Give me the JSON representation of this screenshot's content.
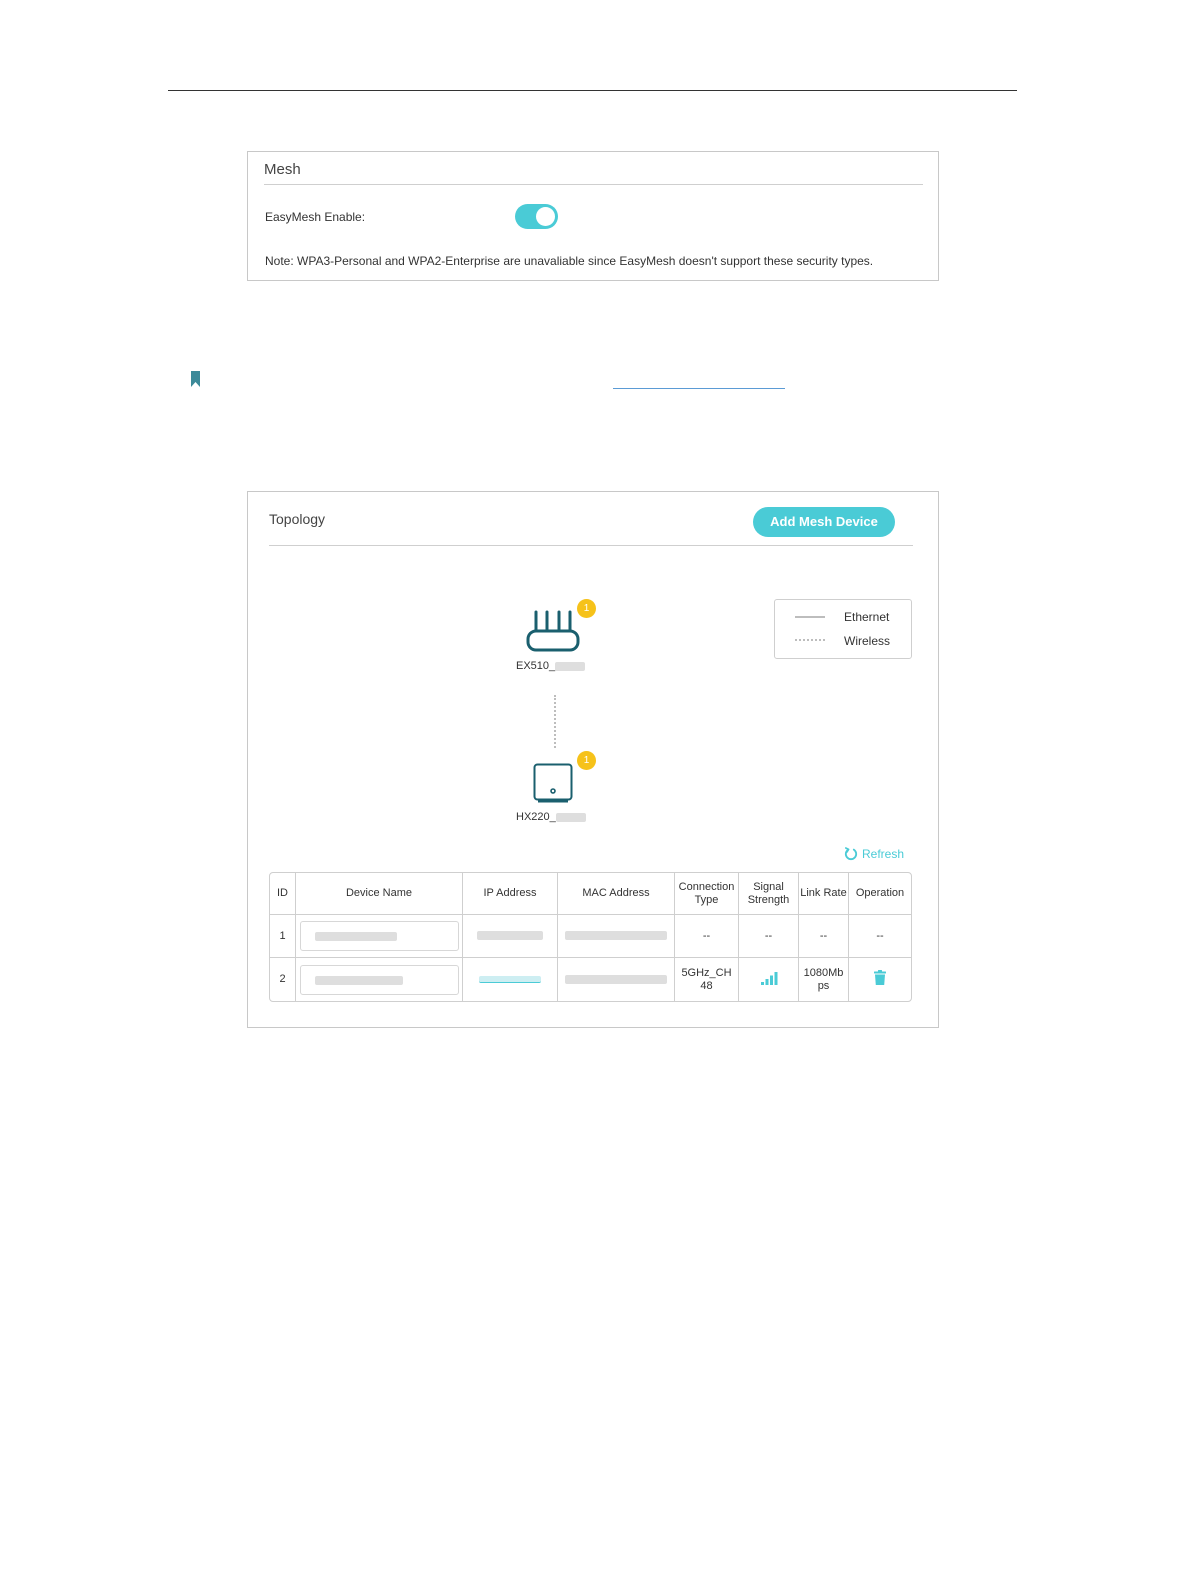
{
  "mesh": {
    "title": "Mesh",
    "easymesh_label": "EasyMesh Enable:",
    "easymesh_enabled": true,
    "note": "Note: WPA3-Personal and WPA2-Enterprise are unavaliable since EasyMesh doesn't support these security types."
  },
  "topology": {
    "title": "Topology",
    "add_button": "Add Mesh Device",
    "legend": {
      "ethernet": "Ethernet",
      "wireless": "Wireless"
    },
    "nodes": [
      {
        "label": "EX510_",
        "badge": "1",
        "icon": "router-icon"
      },
      {
        "label": "HX220_",
        "badge": "1",
        "icon": "satellite-icon"
      }
    ],
    "refresh_label": "Refresh",
    "table": {
      "headers": {
        "id": "ID",
        "device_name": "Device Name",
        "ip": "IP Address",
        "mac": "MAC Address",
        "conn_type": "Connection Type",
        "signal": "Signal Strength",
        "link_rate": "Link Rate",
        "operation": "Operation"
      },
      "rows": [
        {
          "id": "1",
          "conn_type": "--",
          "signal": "--",
          "link_rate": "--",
          "operation": "--"
        },
        {
          "id": "2",
          "conn_type": "5GHz_CH 48",
          "signal_icon": "signal-bars-icon",
          "link_rate": "1080Mb ps",
          "operation_icon": "trash-icon"
        }
      ]
    }
  },
  "colors": {
    "accent": "#4acbd6",
    "badge": "#f6c21a",
    "icon_dark": "#1a5f6e"
  }
}
